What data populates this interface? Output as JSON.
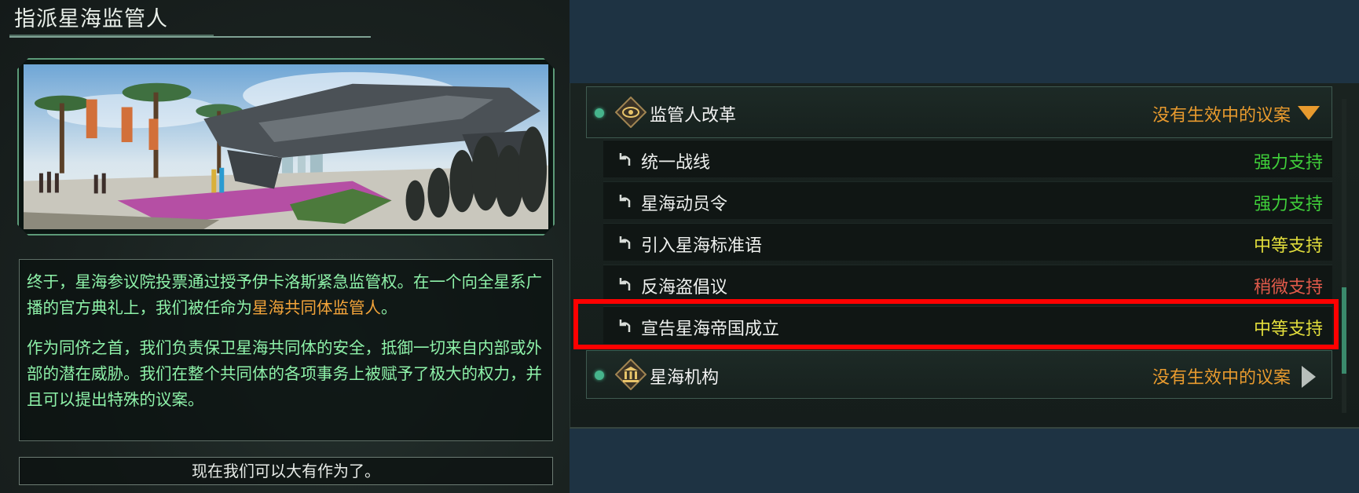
{
  "event": {
    "title": "指派星海监管人",
    "paragraph1_part1": "终于，星海参议院投票通过授予伊卡洛斯紧急监管权。在一个向全星系广播的官方典礼上，我们被任命为",
    "paragraph1_highlight": "星海共同体监管人",
    "paragraph1_part2": "。",
    "paragraph2": "作为同侪之首，我们负责保卫星海共同体的安全，抵御一切来自内部或外部的潜在威胁。我们在整个共同体的各项事务上被赋予了极大的权力，并且可以提出特殊的议案。",
    "response_button": "现在我们可以大有作为了。"
  },
  "agenda": {
    "categories": [
      {
        "label": "监管人改革",
        "status": "没有生效中的议案",
        "icon": "eye-diamond-icon",
        "expanded": true
      },
      {
        "label": "星海机构",
        "status": "没有生效中的议案",
        "icon": "institution-diamond-icon",
        "expanded": false
      }
    ],
    "items": [
      {
        "label": "统一战线",
        "support": "强力支持",
        "level": "strong"
      },
      {
        "label": "星海动员令",
        "support": "强力支持",
        "level": "strong"
      },
      {
        "label": "引入星海标准语",
        "support": "中等支持",
        "level": "medium"
      },
      {
        "label": "反海盗倡议",
        "support": "稍微支持",
        "level": "weak"
      },
      {
        "label": "宣告星海帝国成立",
        "support": "中等支持",
        "level": "medium",
        "highlighted": true
      }
    ]
  },
  "colors": {
    "strong": "#3fcf3a",
    "medium": "#e3df3c",
    "weak": "#e15a4a",
    "status": "#e89a2e",
    "highlight": "#ff0000"
  }
}
